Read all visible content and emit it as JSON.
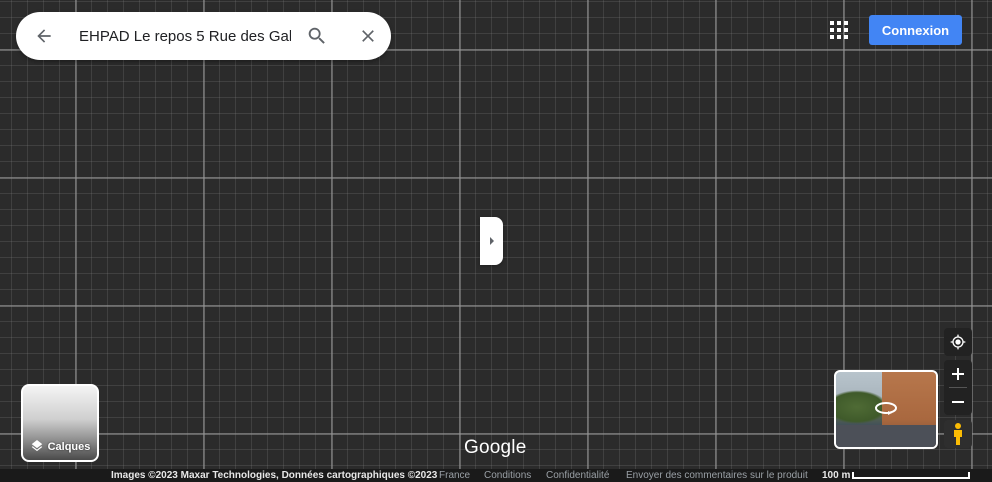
{
  "search": {
    "value": "EHPAD Le repos 5 Rue des Gal"
  },
  "header": {
    "signin_label": "Connexion"
  },
  "layers": {
    "label": "Calques"
  },
  "logo": {
    "text": "Google"
  },
  "footer": {
    "attribution": "Images ©2023 Maxar Technologies, Données cartographiques ©2023",
    "country": "France",
    "terms": "Conditions",
    "privacy": "Confidentialité",
    "feedback": "Envoyer des commentaires sur le produit",
    "scale": "100 m"
  },
  "icons": {
    "back": "arrow-left",
    "search": "magnifier",
    "clear": "close-x",
    "apps": "grid-9-dots",
    "panel_toggle": "caret-right",
    "layers": "layers-stack",
    "locate": "crosshair-target",
    "zoom_in": "plus",
    "zoom_out": "minus",
    "pegman": "street-view-pegman",
    "streetview_rotate": "rotate-360"
  },
  "colors": {
    "accent": "#4285f4",
    "map_background": "#2b2b2b",
    "controls": "#222222",
    "pegman": "#fbbc04"
  }
}
